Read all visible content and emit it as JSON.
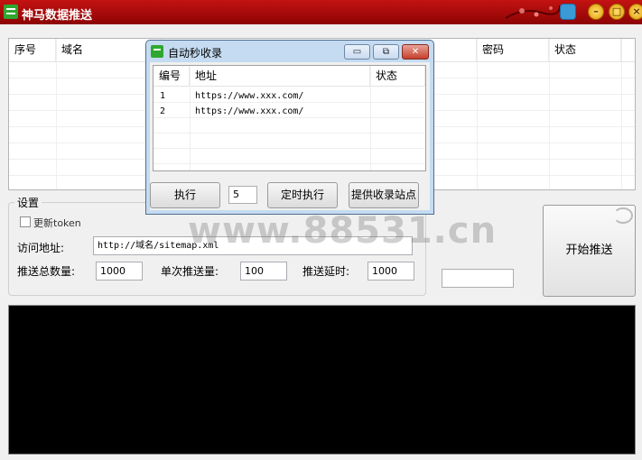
{
  "app": {
    "title": "神马数据推送"
  },
  "main_grid": {
    "columns": [
      "序号",
      "域名",
      "",
      "密码",
      "状态"
    ]
  },
  "settings": {
    "group_title": "设置",
    "update_token_label": "更新token",
    "url_label": "访问地址:",
    "url_value": "http://域名/sitemap.xml",
    "total_label": "推送总数量:",
    "total_value": "1000",
    "single_label": "单次推送量:",
    "single_value": "100",
    "delay_label": "推送延时:",
    "delay_value": "1000"
  },
  "start_button": {
    "label": "开始推送"
  },
  "watermark": "www.88531.cn",
  "dialog": {
    "title": "自动秒收录",
    "controls": {
      "minimize": "▭",
      "restore": "⧉",
      "close": "✕"
    },
    "columns": [
      "编号",
      "地址",
      "状态"
    ],
    "rows": [
      {
        "id": "1",
        "url": "https://www.xxx.com/",
        "status": ""
      },
      {
        "id": "2",
        "url": "https://www.xxx.com/",
        "status": ""
      }
    ],
    "execute_label": "执行",
    "interval_value": "5",
    "timed_execute_label": "定时执行",
    "provide_site_label": "提供收录站点"
  }
}
